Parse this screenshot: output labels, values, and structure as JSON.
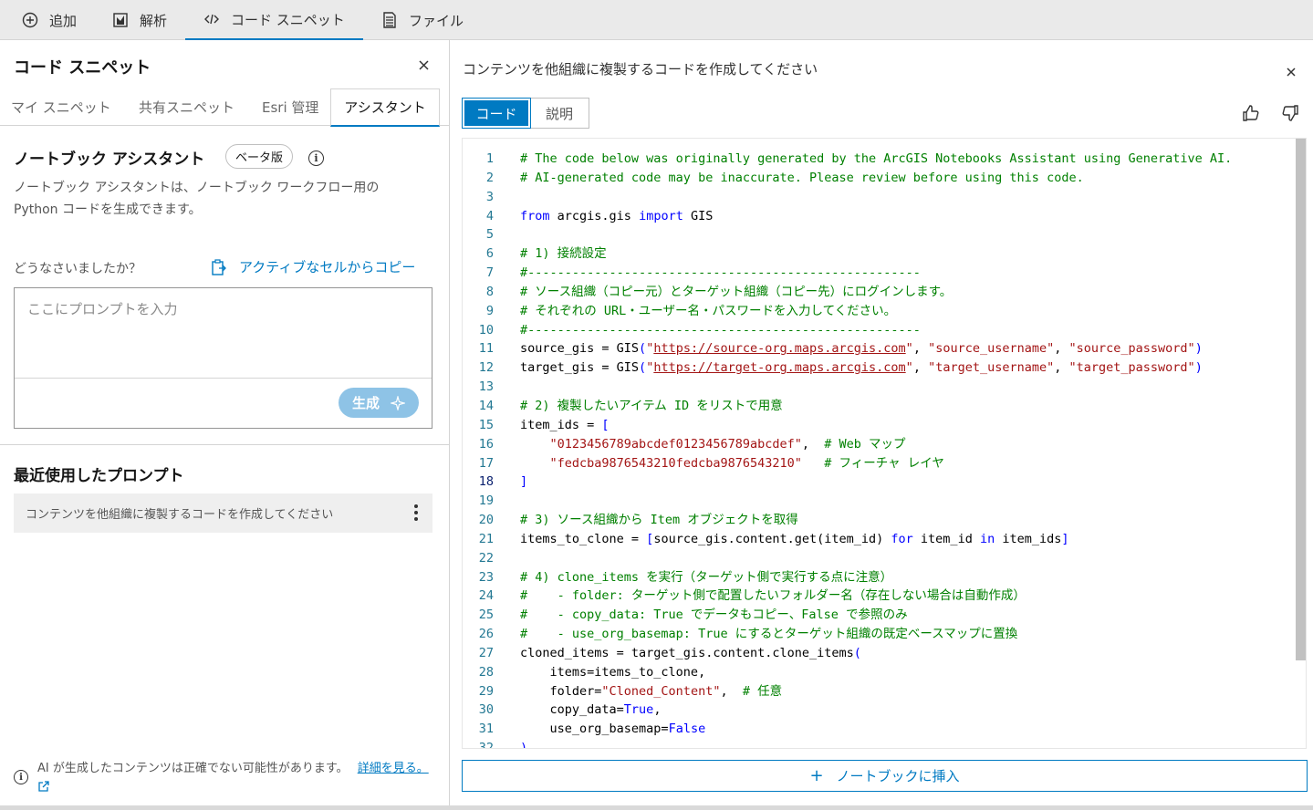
{
  "topbar": {
    "items": [
      {
        "label": "追加",
        "icon": "plus-circle-icon"
      },
      {
        "label": "解析",
        "icon": "analysis-icon"
      },
      {
        "label": "コード スニペット",
        "icon": "code-icon"
      },
      {
        "label": "ファイル",
        "icon": "file-icon"
      }
    ]
  },
  "left": {
    "title": "コード スニペット",
    "tabs": [
      "マイ スニペット",
      "共有スニペット",
      "Esri 管理",
      "アシスタント"
    ],
    "assistant_title": "ノートブック アシスタント",
    "badge": "ベータ版",
    "description": "ノートブック アシスタントは、ノートブック ワークフロー用の Python コードを生成できます。",
    "question_label": "どうなさいましたか？",
    "copy_link": "アクティブなセルからコピー",
    "prompt_placeholder": "ここにプロンプトを入力",
    "generate_label": "生成",
    "recent_title": "最近使用したプロンプト",
    "recent_item": "コンテンツを他組織に複製するコードを作成してください",
    "footer_note": "AI が生成したコンテンツは正確でない可能性があります。",
    "footer_link": "詳細を見る。"
  },
  "right": {
    "title": "コンテンツを他組織に複製するコードを作成してください",
    "seg_code": "コード",
    "seg_explain": "説明",
    "insert_label": "ノートブックに挿入",
    "code": [
      [
        [
          "c",
          "# The code below was originally generated by the ArcGIS Notebooks Assistant using Generative AI."
        ]
      ],
      [
        [
          "c",
          "# AI-generated code may be inaccurate. Please review before using this code."
        ]
      ],
      [],
      [
        [
          "k",
          "from"
        ],
        [
          "t",
          " arcgis.gis "
        ],
        [
          "k",
          "import"
        ],
        [
          "t",
          " GIS"
        ]
      ],
      [],
      [
        [
          "c",
          "# 1) 接続設定"
        ]
      ],
      [
        [
          "c",
          "#-----------------------------------------------------"
        ]
      ],
      [
        [
          "c",
          "# ソース組織（コピー元）とターゲット組織（コピー先）にログインします。"
        ]
      ],
      [
        [
          "c",
          "# それぞれの URL・ユーザー名・パスワードを入力してください。"
        ]
      ],
      [
        [
          "c",
          "#-----------------------------------------------------"
        ]
      ],
      [
        [
          "t",
          "source_gis = GIS"
        ],
        [
          "k",
          "("
        ],
        [
          "s",
          "\""
        ],
        [
          "u",
          "https://source-org.maps.arcgis.com"
        ],
        [
          "s",
          "\""
        ],
        [
          "t",
          ", "
        ],
        [
          "s",
          "\"source_username\""
        ],
        [
          "t",
          ", "
        ],
        [
          "s",
          "\"source_password\""
        ],
        [
          "k",
          ")"
        ]
      ],
      [
        [
          "t",
          "target_gis = GIS"
        ],
        [
          "k",
          "("
        ],
        [
          "s",
          "\""
        ],
        [
          "u",
          "https://target-org.maps.arcgis.com"
        ],
        [
          "s",
          "\""
        ],
        [
          "t",
          ", "
        ],
        [
          "s",
          "\"target_username\""
        ],
        [
          "t",
          ", "
        ],
        [
          "s",
          "\"target_password\""
        ],
        [
          "k",
          ")"
        ]
      ],
      [],
      [
        [
          "c",
          "# 2) 複製したいアイテム ID をリストで用意"
        ]
      ],
      [
        [
          "t",
          "item_ids = "
        ],
        [
          "k",
          "["
        ]
      ],
      [
        [
          "t",
          "    "
        ],
        [
          "s",
          "\"0123456789abcdef0123456789abcdef\""
        ],
        [
          "t",
          ",  "
        ],
        [
          "c",
          "# Web マップ"
        ]
      ],
      [
        [
          "t",
          "    "
        ],
        [
          "s",
          "\"fedcba9876543210fedcba9876543210\""
        ],
        [
          "t",
          "   "
        ],
        [
          "c",
          "# フィーチャ レイヤ"
        ]
      ],
      [
        [
          "k",
          "]"
        ]
      ],
      [],
      [
        [
          "c",
          "# 3) ソース組織から Item オブジェクトを取得"
        ]
      ],
      [
        [
          "t",
          "items_to_clone = "
        ],
        [
          "k",
          "["
        ],
        [
          "t",
          "source_gis.content.get(item_id) "
        ],
        [
          "k",
          "for"
        ],
        [
          "t",
          " item_id "
        ],
        [
          "k",
          "in"
        ],
        [
          "t",
          " item_ids"
        ],
        [
          "k",
          "]"
        ]
      ],
      [],
      [
        [
          "c",
          "# 4) clone_items を実行（ターゲット側で実行する点に注意）"
        ]
      ],
      [
        [
          "c",
          "#    - folder: ターゲット側で配置したいフォルダー名（存在しない場合は自動作成）"
        ]
      ],
      [
        [
          "c",
          "#    - copy_data: True でデータもコピー、False で参照のみ"
        ]
      ],
      [
        [
          "c",
          "#    - use_org_basemap: True にするとターゲット組織の既定ベースマップに置換"
        ]
      ],
      [
        [
          "t",
          "cloned_items = target_gis.content.clone_items"
        ],
        [
          "k",
          "("
        ]
      ],
      [
        [
          "t",
          "    items=items_to_clone,"
        ]
      ],
      [
        [
          "t",
          "    folder="
        ],
        [
          "s",
          "\"Cloned_Content\""
        ],
        [
          "t",
          ",  "
        ],
        [
          "c",
          "# 任意"
        ]
      ],
      [
        [
          "t",
          "    copy_data="
        ],
        [
          "k",
          "True"
        ],
        [
          "t",
          ","
        ]
      ],
      [
        [
          "t",
          "    use_org_basemap="
        ],
        [
          "k",
          "False"
        ]
      ],
      [
        [
          "k",
          ")"
        ]
      ]
    ],
    "current_line": 18
  }
}
